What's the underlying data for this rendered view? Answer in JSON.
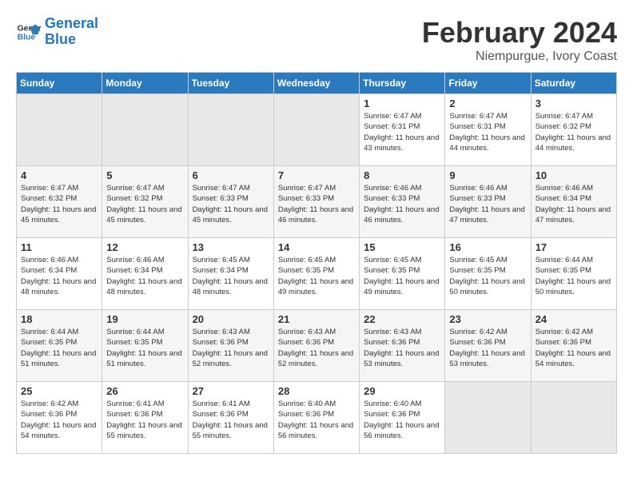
{
  "logo": {
    "text_general": "General",
    "text_blue": "Blue"
  },
  "title": "February 2024",
  "subtitle": "Niempurgue, Ivory Coast",
  "days_of_week": [
    "Sunday",
    "Monday",
    "Tuesday",
    "Wednesday",
    "Thursday",
    "Friday",
    "Saturday"
  ],
  "weeks": [
    [
      {
        "day": "",
        "info": ""
      },
      {
        "day": "",
        "info": ""
      },
      {
        "day": "",
        "info": ""
      },
      {
        "day": "",
        "info": ""
      },
      {
        "day": "1",
        "info": "Sunrise: 6:47 AM\nSunset: 6:31 PM\nDaylight: 11 hours and 43 minutes."
      },
      {
        "day": "2",
        "info": "Sunrise: 6:47 AM\nSunset: 6:31 PM\nDaylight: 11 hours and 44 minutes."
      },
      {
        "day": "3",
        "info": "Sunrise: 6:47 AM\nSunset: 6:32 PM\nDaylight: 11 hours and 44 minutes."
      }
    ],
    [
      {
        "day": "4",
        "info": "Sunrise: 6:47 AM\nSunset: 6:32 PM\nDaylight: 11 hours and 45 minutes."
      },
      {
        "day": "5",
        "info": "Sunrise: 6:47 AM\nSunset: 6:32 PM\nDaylight: 11 hours and 45 minutes."
      },
      {
        "day": "6",
        "info": "Sunrise: 6:47 AM\nSunset: 6:33 PM\nDaylight: 11 hours and 45 minutes."
      },
      {
        "day": "7",
        "info": "Sunrise: 6:47 AM\nSunset: 6:33 PM\nDaylight: 11 hours and 46 minutes."
      },
      {
        "day": "8",
        "info": "Sunrise: 6:46 AM\nSunset: 6:33 PM\nDaylight: 11 hours and 46 minutes."
      },
      {
        "day": "9",
        "info": "Sunrise: 6:46 AM\nSunset: 6:33 PM\nDaylight: 11 hours and 47 minutes."
      },
      {
        "day": "10",
        "info": "Sunrise: 6:46 AM\nSunset: 6:34 PM\nDaylight: 11 hours and 47 minutes."
      }
    ],
    [
      {
        "day": "11",
        "info": "Sunrise: 6:46 AM\nSunset: 6:34 PM\nDaylight: 11 hours and 48 minutes."
      },
      {
        "day": "12",
        "info": "Sunrise: 6:46 AM\nSunset: 6:34 PM\nDaylight: 11 hours and 48 minutes."
      },
      {
        "day": "13",
        "info": "Sunrise: 6:45 AM\nSunset: 6:34 PM\nDaylight: 11 hours and 48 minutes."
      },
      {
        "day": "14",
        "info": "Sunrise: 6:45 AM\nSunset: 6:35 PM\nDaylight: 11 hours and 49 minutes."
      },
      {
        "day": "15",
        "info": "Sunrise: 6:45 AM\nSunset: 6:35 PM\nDaylight: 11 hours and 49 minutes."
      },
      {
        "day": "16",
        "info": "Sunrise: 6:45 AM\nSunset: 6:35 PM\nDaylight: 11 hours and 50 minutes."
      },
      {
        "day": "17",
        "info": "Sunrise: 6:44 AM\nSunset: 6:35 PM\nDaylight: 11 hours and 50 minutes."
      }
    ],
    [
      {
        "day": "18",
        "info": "Sunrise: 6:44 AM\nSunset: 6:35 PM\nDaylight: 11 hours and 51 minutes."
      },
      {
        "day": "19",
        "info": "Sunrise: 6:44 AM\nSunset: 6:35 PM\nDaylight: 11 hours and 51 minutes."
      },
      {
        "day": "20",
        "info": "Sunrise: 6:43 AM\nSunset: 6:36 PM\nDaylight: 11 hours and 52 minutes."
      },
      {
        "day": "21",
        "info": "Sunrise: 6:43 AM\nSunset: 6:36 PM\nDaylight: 11 hours and 52 minutes."
      },
      {
        "day": "22",
        "info": "Sunrise: 6:43 AM\nSunset: 6:36 PM\nDaylight: 11 hours and 53 minutes."
      },
      {
        "day": "23",
        "info": "Sunrise: 6:42 AM\nSunset: 6:36 PM\nDaylight: 11 hours and 53 minutes."
      },
      {
        "day": "24",
        "info": "Sunrise: 6:42 AM\nSunset: 6:36 PM\nDaylight: 11 hours and 54 minutes."
      }
    ],
    [
      {
        "day": "25",
        "info": "Sunrise: 6:42 AM\nSunset: 6:36 PM\nDaylight: 11 hours and 54 minutes."
      },
      {
        "day": "26",
        "info": "Sunrise: 6:41 AM\nSunset: 6:36 PM\nDaylight: 11 hours and 55 minutes."
      },
      {
        "day": "27",
        "info": "Sunrise: 6:41 AM\nSunset: 6:36 PM\nDaylight: 11 hours and 55 minutes."
      },
      {
        "day": "28",
        "info": "Sunrise: 6:40 AM\nSunset: 6:36 PM\nDaylight: 11 hours and 56 minutes."
      },
      {
        "day": "29",
        "info": "Sunrise: 6:40 AM\nSunset: 6:36 PM\nDaylight: 11 hours and 56 minutes."
      },
      {
        "day": "",
        "info": ""
      },
      {
        "day": "",
        "info": ""
      }
    ]
  ]
}
